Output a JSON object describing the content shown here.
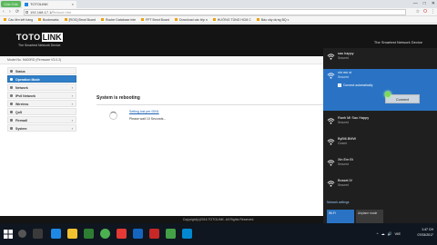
{
  "browser": {
    "brand": "Cốc Cốc",
    "tab_title": "TOTOLINK",
    "tab_close": "×",
    "url_host": "192.168.17.1/",
    "url_path": "Reboot.htm",
    "window_controls": [
      "—",
      "□",
      "✕"
    ],
    "nav": [
      "‹",
      "›",
      "⟳"
    ],
    "bookmarks": [
      "Các liên kết hàng",
      "Bookmarks",
      "[ROG] Bmot Board",
      "Router Database inte",
      "FPT Bmot Board",
      "Download các tệp n",
      "HƯỚNG TÙNG HCM C",
      "Báo xây dựng BQ v"
    ],
    "toolbar_icons": [
      "☆",
      "O",
      "⋮"
    ]
  },
  "router": {
    "brand_toto": "TOTO",
    "brand_link": "LINK",
    "tagline": "The Smartest Network Device",
    "header_slogan": "The Smartest Network Device",
    "model_line": "Model No. N600RD (Firmware V3.0.2)",
    "menu": [
      {
        "label": "Status",
        "active": false
      },
      {
        "label": "Operation Mode",
        "active": true
      },
      {
        "label": "Network",
        "active": false
      },
      {
        "label": "IPv6 Network",
        "active": false
      },
      {
        "label": "Wireless",
        "active": false
      },
      {
        "label": "QoS",
        "active": false
      },
      {
        "label": "Firewall",
        "active": false
      },
      {
        "label": "System",
        "active": false
      }
    ],
    "reboot_title": "System is rebooting",
    "ssid_link": "Setting lost per 00N1",
    "wait_message": "Please wait 10 Seconds...",
    "footer": "Copyright(c)2016 TOTOLINK. All Rights Reserved."
  },
  "wifi_flyout": {
    "networks": [
      {
        "name": "sau happy",
        "status": "Secured"
      },
      {
        "name": "xin mn oi",
        "status": "Secured",
        "selected": true,
        "auto_connect": "Connect automatically",
        "connect_label": "Connect"
      },
      {
        "name": "Ranh MI Sau Happy",
        "status": "Secured"
      },
      {
        "name": "ByBill-BMW",
        "status": "Closed"
      },
      {
        "name": "Xin Em Đi",
        "status": "Secured"
      },
      {
        "name": "Bossel-lV",
        "status": "Secured"
      }
    ],
    "settings_link": "Network settings",
    "quick_wifi": "Wi-Fi",
    "quick_airplane": "Airplane mode"
  },
  "taskbar": {
    "time": "1:47 CH",
    "date": "07/03/2017",
    "tray_icons": [
      "^",
      "☁",
      "🔊",
      "VIE"
    ]
  },
  "colors": {
    "accent_blue": "#2f7fc8",
    "header_black": "#141414",
    "flyout_bg": "#1f1f1f",
    "selected_network": "#2a73c4"
  }
}
